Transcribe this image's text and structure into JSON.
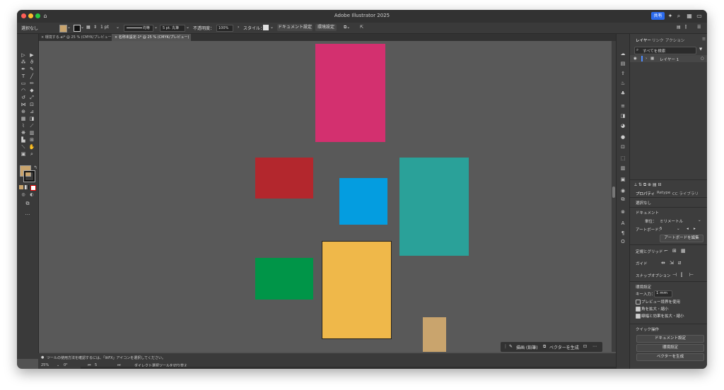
{
  "window": {
    "title": "Adobe Illustrator 2025",
    "share_label": "共有"
  },
  "controlbar": {
    "selection": "選択なし",
    "stroke_weight": "1 pt",
    "stroke_profile": "均等",
    "brush": "5 pt. 丸筆",
    "opacity_label": "不透明度：",
    "opacity_value": "100%",
    "style_label": "スタイル：",
    "document_setup": "ドキュメント設定",
    "preferences": "環境設定"
  },
  "doc_tabs": [
    {
      "label": "× 環境する.ai* @ 25 % (CMYK/プレビュー)",
      "active": false
    },
    {
      "label": "× 名称未設定-1* @ 25 % (CMYK/プレビュー)",
      "active": true
    }
  ],
  "canvas": {
    "shapes": [
      {
        "name": "pink-rectangle",
        "color": "#d3306f"
      },
      {
        "name": "red-rectangle",
        "color": "#b3272d"
      },
      {
        "name": "blue-rectangle",
        "color": "#049de0"
      },
      {
        "name": "teal-rectangle",
        "color": "#2aa199"
      },
      {
        "name": "green-rectangle",
        "color": "#009548"
      },
      {
        "name": "yellow-rectangle",
        "color": "#efb84a"
      },
      {
        "name": "tan-rectangle",
        "color": "#c9a46d"
      }
    ]
  },
  "context_bar": {
    "draw_label": "描画 (鉛筆)",
    "vectorize_label": "ベクターを生成"
  },
  "statusbar": {
    "hint": "ツールの使用方法を確認するには、「litFX」アイコンを選択してください。",
    "zoom": "25%",
    "angle": "0°",
    "artboard_number": "5",
    "tool_name": "ダイレクト選択ツールを切り替え"
  },
  "panel": {
    "tabs": [
      "レイヤー",
      "リンク",
      "アクション"
    ],
    "search_placeholder": "すべてを検索",
    "layer_name": "レイヤー 1",
    "props_tabs": [
      "プロパティ",
      "Retype",
      "CC ライブラリ"
    ],
    "no_selection": "選択なし",
    "document_heading": "ドキュメント",
    "units_label": "単位：",
    "units_value": "ミリメートル",
    "artboard_label": "アートボード：",
    "artboard_value": "5",
    "edit_artboards": "アートボードを編集",
    "rulers_grid": "定規とグリッド",
    "guides": "ガイド",
    "snap_options": "スナップオプション",
    "preferences_heading": "環境設定",
    "keyboard_increment_label": "キー入力：",
    "keyboard_increment_value": "1 mm",
    "use_preview_bounds": "プレビュー境界を使用",
    "scale_corners": "角を拡大・縮小",
    "scale_strokes": "線幅と効果を拡大・縮小",
    "quick_actions": "クイック操作",
    "qa_document_setup": "ドキュメント設定",
    "qa_preferences": "環境設定",
    "qa_generate_vectors": "ベクターを生成"
  },
  "colors": {
    "fill_swatch": "#c9a46d",
    "accent": "#2c6bed"
  }
}
